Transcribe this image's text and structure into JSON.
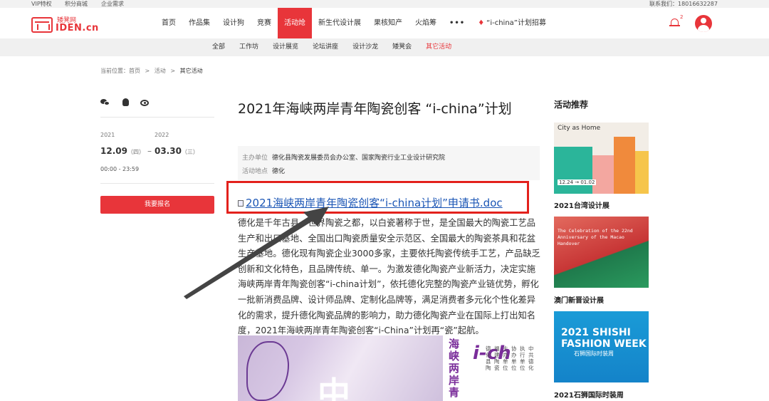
{
  "topbar": {
    "left": [
      "VIP特权",
      "积分商城",
      "企业需求"
    ],
    "right": "联系我们：18016632287"
  },
  "logo": {
    "cn": "矮凳网",
    "en": "IDEN.cn"
  },
  "nav": {
    "items": [
      "首页",
      "作品集",
      "设计狗",
      "竞赛",
      "活动炝",
      "新生代设计展",
      "果核知产",
      "火焰筹"
    ],
    "active_index": 4,
    "more": "•••",
    "recruit": "“i-china”计划招募"
  },
  "notifications": {
    "count": "2"
  },
  "subnav": {
    "items": [
      "全部",
      "工作坊",
      "设计展览",
      "论坛讲座",
      "设计沙龙",
      "矮凳会",
      "其它活动"
    ],
    "active_index": 6
  },
  "breadcrumb": {
    "prefix": "当前位置：首页",
    "sep": ">",
    "level1": "活动",
    "current": "其它活动"
  },
  "event": {
    "start_year": "2021",
    "end_year": "2022",
    "start_date": "12.09",
    "start_weekday": "（四）",
    "dash": "–",
    "end_date": "03.30",
    "end_weekday": "（三）",
    "time": "00:00 - 23:59",
    "signup_label": "我要报名"
  },
  "article": {
    "title": "2021年海峡两岸青年陶瓷创客 “i-china”计划",
    "organizer_label": "主办单位",
    "organizer": "德化县陶瓷发展委员会办公室、国家陶瓷行业工业设计研究院",
    "location_label": "活动地点",
    "location": "德化",
    "attachment": "2021海峡两岸青年陶瓷创客“i-china计划”申请书.doc",
    "body": "德化是千年古县、世界陶瓷之都，以白瓷著称于世，是全国最大的陶瓷工艺品生产和出口基地、全国出口陶瓷质量安全示范区、全国最大的陶瓷茶具和花盆生产基地。德化现有陶瓷企业3000多家，主要依托陶瓷传统手工艺，产品缺乏创新和文化特色，且品牌传统、单一。为激发德化陶瓷产业新活力，决定实施海峡两岸青年陶瓷创客“i-china计划”，依托德化完整的陶瓷产业链优势，孵化一批新消费品牌、设计师品牌、定制化品牌等，满足消费者多元化个性化差异化的需求，提升德化陶瓷品牌的影响力，助力德化陶瓷产业在国际上打出知名度，2021年海峡两岸青年陶瓷创客“i-China”计划再“瓷”起航。"
  },
  "poster": {
    "big_char": "中",
    "vertical_title": "海峡两岸青",
    "latin": "i-ch",
    "col1": "协办单位",
    "col2": "执行单位",
    "col3": "主办单位",
    "col4": "中共德化",
    "col5": "福建陶瓷",
    "col6": "德化县陶"
  },
  "sidebar": {
    "title": "活动推荐",
    "items": [
      {
        "label": "2021台湾设计展",
        "img_text": "City as Home",
        "img_sub": "12.24 → 01.02"
      },
      {
        "label": "澳门新晋设计展",
        "img_text": "The Celebration of the 22nd Anniversary of the Macao Handover"
      },
      {
        "label": "2021石狮国际时装周",
        "img_text": "2021 SHISHI FASHION WEEK",
        "img_sub": "石狮国际时装周"
      }
    ]
  },
  "colors": {
    "brand": "#e8353a",
    "link": "#1a55b5",
    "highlight_box": "#e3211c"
  }
}
